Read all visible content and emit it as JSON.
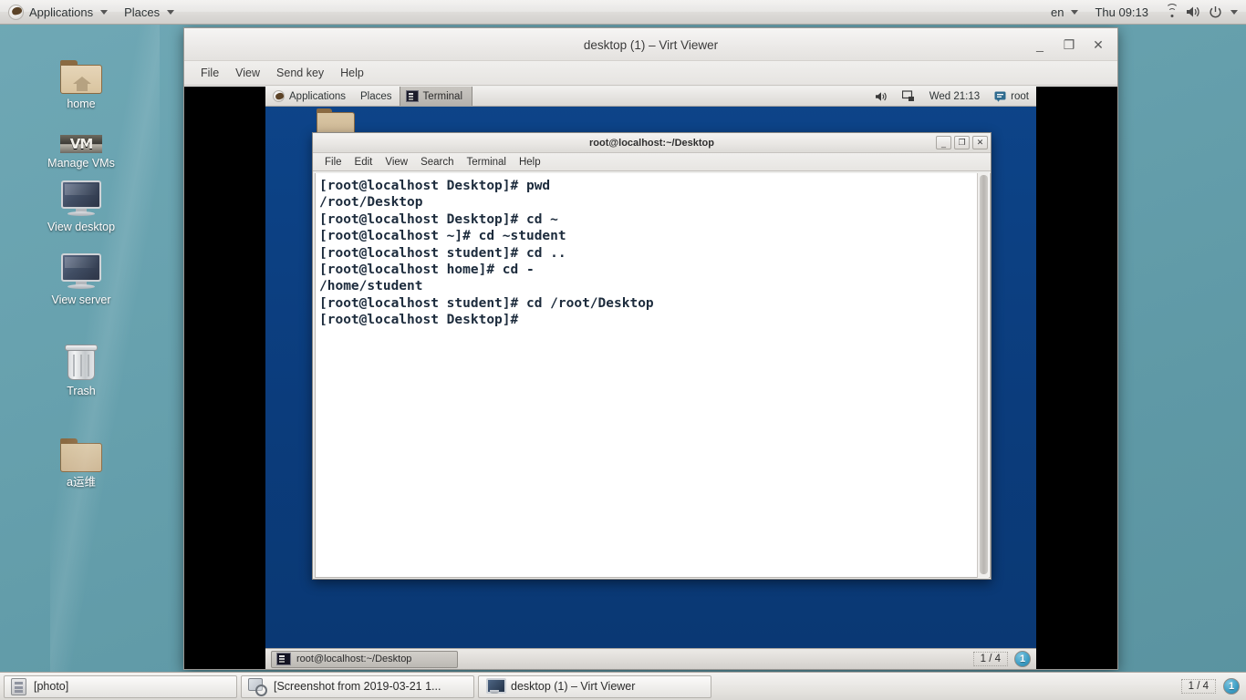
{
  "host": {
    "top_panel": {
      "applications": "Applications",
      "places": "Places",
      "keyboard_layout": "en",
      "clock": "Thu 09:13",
      "icons": [
        "gnome-foot-icon",
        "wifi-icon",
        "volume-icon",
        "power-icon"
      ]
    },
    "desktop_icons": [
      {
        "label": "home",
        "icon": "home-folder-icon"
      },
      {
        "label": "Manage VMs",
        "icon": "virt-manager-icon"
      },
      {
        "label": "View desktop",
        "icon": "monitor-icon"
      },
      {
        "label": "View server",
        "icon": "monitor-icon"
      },
      {
        "label": "Trash",
        "icon": "trash-icon"
      },
      {
        "label": "a运维",
        "icon": "folder-icon"
      }
    ],
    "taskbar": {
      "buttons": [
        {
          "label": "[photo]",
          "icon": "photo-icon"
        },
        {
          "label": "[Screenshot from 2019-03-21 1...",
          "icon": "screenshot-icon"
        },
        {
          "label": "desktop (1) – Virt Viewer",
          "icon": "virt-viewer-icon"
        }
      ],
      "workspace_indicator": "1 / 4",
      "workspace_badge": "1"
    }
  },
  "virt_viewer": {
    "title": "desktop (1) – Virt Viewer",
    "menu": [
      "File",
      "View",
      "Send key",
      "Help"
    ],
    "window_buttons": {
      "minimize": "_",
      "maximize": "❐",
      "close": "✕"
    }
  },
  "guest": {
    "top_panel": {
      "applications": "Applications",
      "places": "Places",
      "active_task": "Terminal",
      "clock": "Wed 21:13",
      "user": "root",
      "icons": [
        "gnome-foot-icon",
        "volume-icon",
        "network-icon",
        "user-icon"
      ]
    },
    "terminal": {
      "title": "root@localhost:~/Desktop",
      "menu": [
        "File",
        "Edit",
        "View",
        "Search",
        "Terminal",
        "Help"
      ],
      "window_buttons": {
        "minimize": "_",
        "maximize": "❐",
        "close": "✕"
      },
      "content": "[root@localhost Desktop]# pwd\n/root/Desktop\n[root@localhost Desktop]# cd ~\n[root@localhost ~]# cd ~student\n[root@localhost student]# cd ..\n[root@localhost home]# cd -\n/home/student\n[root@localhost student]# cd /root/Desktop\n[root@localhost Desktop]#"
    },
    "bottom_panel": {
      "task_label": "root@localhost:~/Desktop",
      "workspace_indicator": "1 / 4",
      "workspace_badge": "1"
    }
  },
  "colors": {
    "host_desktop": "#67a1ae",
    "guest_desktop": "#0b4085",
    "terminal_bg": "#ffffff",
    "terminal_fg": "#1c2b3c",
    "panel_bg": "#e6e4e1",
    "badge_accent": "#3d9dc4"
  }
}
